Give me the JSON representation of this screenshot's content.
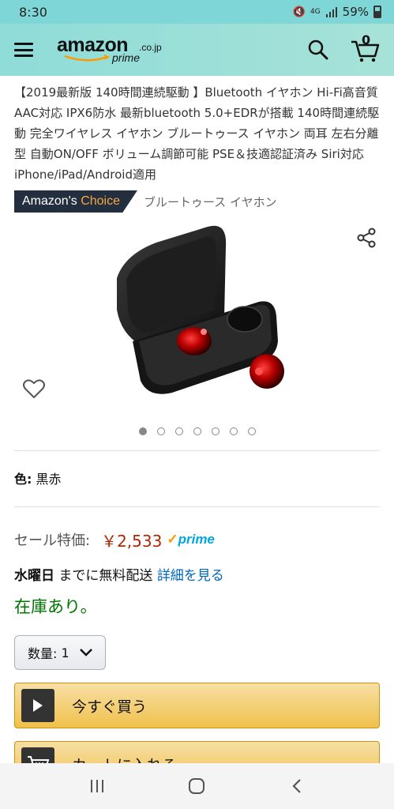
{
  "status_bar": {
    "time": "8:30",
    "network": "4G",
    "battery": "59%"
  },
  "header": {
    "logo_text": "amazon",
    "logo_domain": ".co.jp",
    "logo_prime": "prime",
    "cart_count": "0"
  },
  "product": {
    "title": "【2019最新版 140時間連続駆動 】Bluetooth イヤホン Hi-Fi高音質 AAC対応 IPX6防水 最新bluetooth 5.0+EDRが搭載 140時間連続駆動 完全ワイヤレス イヤホン ブルートゥース イヤホン 両耳 左右分離型 自動ON/OFF ボリューム調節可能 PSE＆技適認証済み Siri対応 iPhone/iPad/Android適用",
    "badge_part1": "Amazon's",
    "badge_part2": "Choice",
    "badge_category": "ブルートゥース イヤホン",
    "image_count": 7,
    "active_image": 1
  },
  "color": {
    "label": "色:",
    "value": "黒赤"
  },
  "price": {
    "label": "セール特価:",
    "value": "￥2,533",
    "prime": "prime"
  },
  "delivery": {
    "day": "水曜日",
    "text": "までに無料配送",
    "link": "詳細を見る"
  },
  "stock": "在庫あり。",
  "quantity": {
    "label": "数量:",
    "value": "1"
  },
  "buttons": {
    "buy_now": "今すぐ買う",
    "add_to_cart": "カートに入れる"
  },
  "colors": {
    "app_bar": "#8fdcd8",
    "price": "#b12704",
    "stock": "#007600",
    "link": "#0066c0",
    "button": "#f0c14b",
    "badge": "#232f3e"
  }
}
